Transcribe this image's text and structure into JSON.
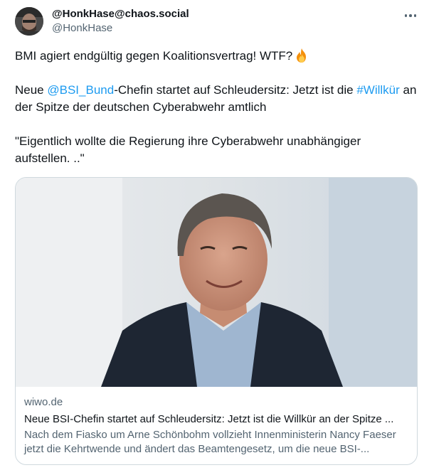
{
  "author": {
    "display_name": "@HonkHase@chaos.social",
    "handle": "@HonkHase"
  },
  "tweet": {
    "line1_text": "BMI agiert endgültig gegen Koalitionsvertrag! WTF?",
    "line1_emoji": "fire-emoji",
    "line2_prefix": "Neue ",
    "line2_mention": "@BSI_Bund",
    "line2_middle": "-Chefin startet auf Schleudersitz: Jetzt ist die ",
    "line2_hashtag": "#Willkür",
    "line2_suffix": " an der Spitze der deutschen Cyberabwehr amtlich",
    "quote": "\"Eigentlich wollte die Regierung ihre Cyberabwehr unabhängiger aufstellen. ..\""
  },
  "card": {
    "domain": "wiwo.de",
    "title": "Neue BSI-Chefin startet auf Schleudersitz: Jetzt ist die Willkür an der Spitze ...",
    "description": "Nach dem Fiasko um Arne Schönbohm vollzieht Innenministerin Nancy Faeser jetzt die Kehrtwende und ändert das Beamtengesetz, um die neue BSI-..."
  },
  "colors": {
    "link": "#1d9bf0",
    "secondary_text": "#536471",
    "border": "#cfd9de"
  },
  "icons": {
    "more": "more-horizontal-icon",
    "emoji": "fire-emoji"
  }
}
